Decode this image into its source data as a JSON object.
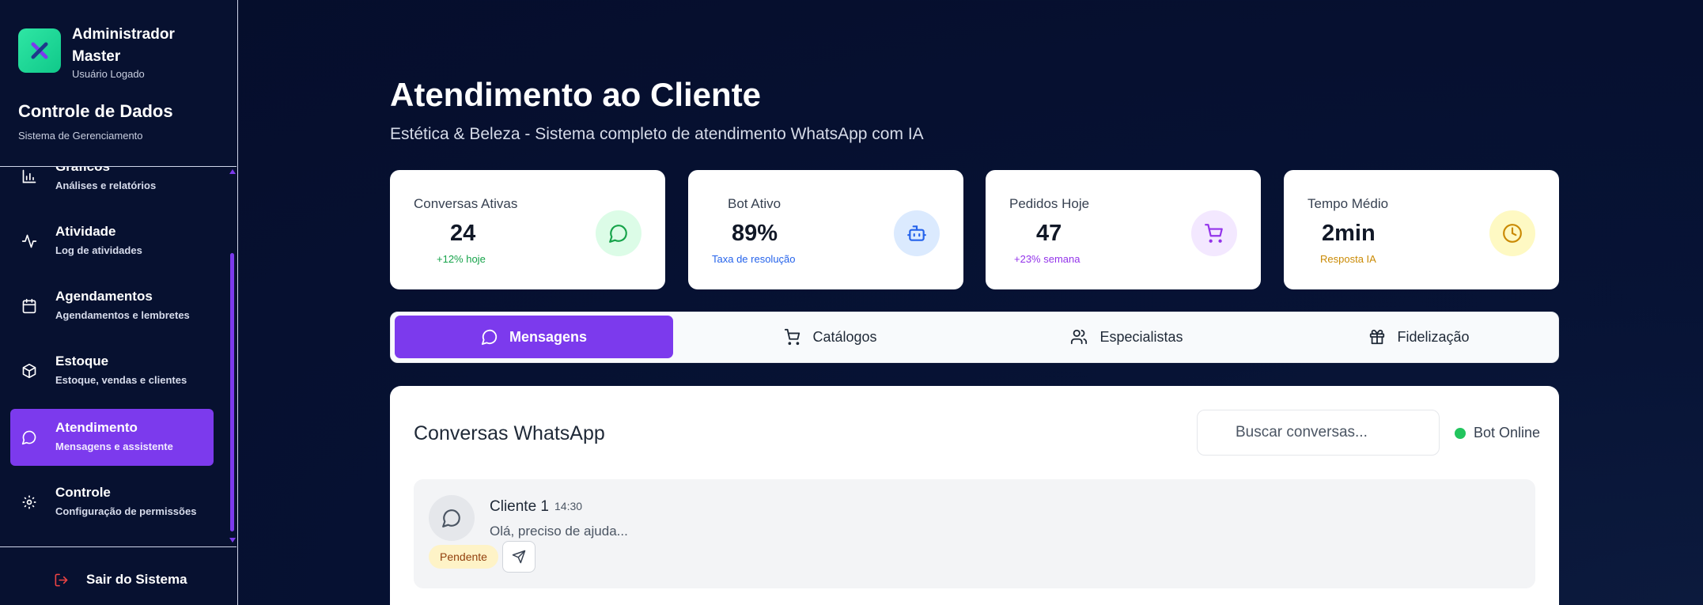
{
  "sidebar": {
    "profile": {
      "name": "Administrador Master",
      "role": "Usuário Logado"
    },
    "app_title": "Controle de Dados",
    "app_subtitle": "Sistema de Gerenciamento",
    "items": [
      {
        "label": "Gráficos",
        "desc": "Análises e relatórios",
        "icon": "bar-chart-icon"
      },
      {
        "label": "Atividade",
        "desc": "Log de atividades",
        "icon": "activity-icon"
      },
      {
        "label": "Agendamentos",
        "desc": "Agendamentos e lembretes",
        "icon": "calendar-icon"
      },
      {
        "label": "Estoque",
        "desc": "Estoque, vendas e clientes",
        "icon": "package-icon"
      },
      {
        "label": "Atendimento",
        "desc": "Mensagens e assistente",
        "icon": "chat-icon",
        "active": true
      },
      {
        "label": "Controle",
        "desc": "Configuração de permissões",
        "icon": "gear-icon"
      }
    ],
    "logout_label": "Sair do Sistema"
  },
  "header": {
    "title": "Atendimento ao Cliente",
    "subtitle": "Estética & Beleza - Sistema completo de atendimento WhatsApp com IA"
  },
  "stats": [
    {
      "label": "Conversas Ativas",
      "value": "24",
      "note": "+12% hoje",
      "note_color": "#16a34a",
      "icon": "chat-icon",
      "icon_bg": "#dcfce7",
      "icon_color": "#16a34a"
    },
    {
      "label": "Bot Ativo",
      "value": "89%",
      "note": "Taxa de resolução",
      "note_color": "#2563eb",
      "icon": "robot-icon",
      "icon_bg": "#dbeafe",
      "icon_color": "#2563eb"
    },
    {
      "label": "Pedidos Hoje",
      "value": "47",
      "note": "+23% semana",
      "note_color": "#9333ea",
      "icon": "cart-icon",
      "icon_bg": "#f3e8ff",
      "icon_color": "#9333ea"
    },
    {
      "label": "Tempo Médio",
      "value": "2min",
      "note": "Resposta IA",
      "note_color": "#ca8a04",
      "icon": "clock-icon",
      "icon_bg": "#fef9c3",
      "icon_color": "#ca8a04"
    }
  ],
  "tabs": [
    {
      "label": "Mensagens",
      "icon": "chat-icon",
      "active": true
    },
    {
      "label": "Catálogos",
      "icon": "cart-icon"
    },
    {
      "label": "Especialistas",
      "icon": "users-icon"
    },
    {
      "label": "Fidelização",
      "icon": "gift-icon"
    }
  ],
  "panel": {
    "title": "Conversas WhatsApp",
    "search_placeholder": "Buscar conversas...",
    "bot_status": "Bot Online",
    "conversations": [
      {
        "name": "Cliente 1",
        "time": "14:30",
        "message": "Olá, preciso de ajuda...",
        "status": "Pendente"
      }
    ]
  },
  "colors": {
    "accent": "#7c3aed",
    "sidebar_bg": "#071130",
    "online": "#22c55e"
  }
}
